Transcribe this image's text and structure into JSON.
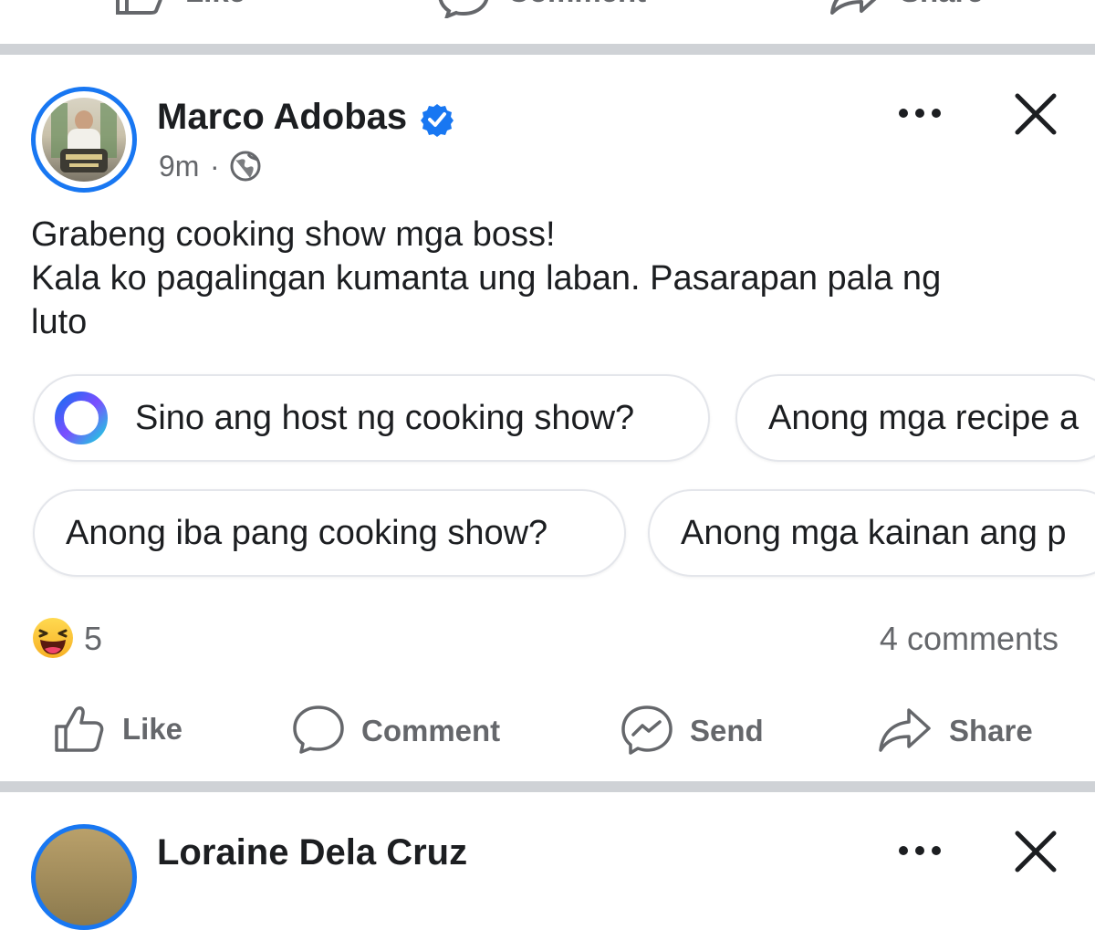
{
  "prev_post": {
    "actions": {
      "like": "Like",
      "comment": "Comment",
      "share": "Share"
    }
  },
  "post": {
    "author": "Marco Adobas",
    "verified": true,
    "time": "9m",
    "separator": "·",
    "privacy_icon": "globe-icon",
    "lines": [
      "Grabeng cooking show mga boss!",
      "Kala ko pagalingan kumanta ung laban. Pasarapan pala ng",
      "luto"
    ],
    "suggestions": [
      "Sino ang host ng cooking show?",
      "Anong mga recipe a",
      "Anong iba pang cooking show?",
      "Anong mga kainan ang p"
    ],
    "reaction_count": "5",
    "reaction_icon": "haha-emoji-icon",
    "comments_count": "4 comments",
    "actions": {
      "like": "Like",
      "comment": "Comment",
      "send": "Send",
      "share": "Share"
    }
  },
  "next_post": {
    "author": "Loraine Dela Cruz"
  },
  "colors": {
    "accent": "#1877f2",
    "muted": "#65676b",
    "divider": "#cfd2d6",
    "text": "#1c1e21"
  }
}
